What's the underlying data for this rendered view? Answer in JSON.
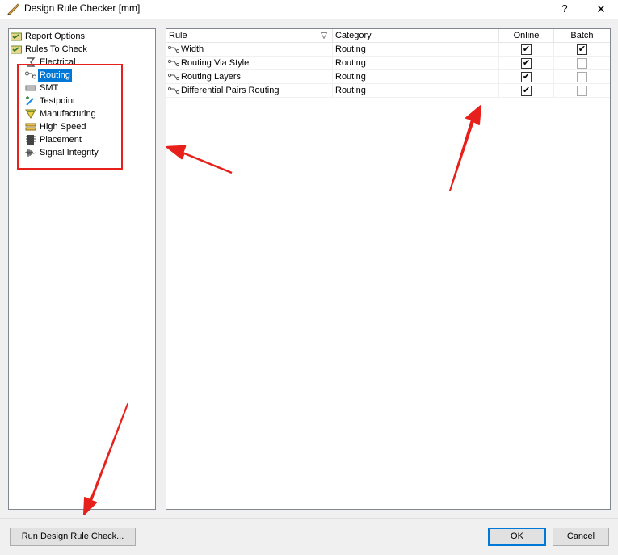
{
  "window": {
    "title": "Design Rule Checker [mm]",
    "help_label": "?",
    "close_label": "✕"
  },
  "tree": {
    "items": [
      {
        "label": "Report Options",
        "icon": "folder-check-icon",
        "selected": false
      },
      {
        "label": "Rules To Check",
        "icon": "folder-check-icon",
        "selected": false
      },
      {
        "label": "Electrical",
        "icon": "electrical-icon",
        "selected": false
      },
      {
        "label": "Routing",
        "icon": "routing-icon",
        "selected": true
      },
      {
        "label": "SMT",
        "icon": "smt-icon",
        "selected": false
      },
      {
        "label": "Testpoint",
        "icon": "testpoint-icon",
        "selected": false
      },
      {
        "label": "Manufacturing",
        "icon": "manufacturing-icon",
        "selected": false
      },
      {
        "label": "High Speed",
        "icon": "high-speed-icon",
        "selected": false
      },
      {
        "label": "Placement",
        "icon": "placement-icon",
        "selected": false
      },
      {
        "label": "Signal Integrity",
        "icon": "signal-integrity-icon",
        "selected": false
      }
    ]
  },
  "grid": {
    "columns": {
      "rule": "Rule",
      "category": "Category",
      "online": "Online",
      "batch": "Batch"
    },
    "rows": [
      {
        "rule": "Width",
        "category": "Routing",
        "online": true,
        "batch": true
      },
      {
        "rule": "Routing Via Style",
        "category": "Routing",
        "online": true,
        "batch": false
      },
      {
        "rule": "Routing Layers",
        "category": "Routing",
        "online": true,
        "batch": false
      },
      {
        "rule": "Differential Pairs Routing",
        "category": "Routing",
        "online": true,
        "batch": false
      }
    ]
  },
  "footer": {
    "run_label_accel": "R",
    "run_label_rest": "un Design Rule Check...",
    "ok_label": "OK",
    "cancel_label": "Cancel"
  },
  "colors": {
    "selection": "#0078d7",
    "annotation": "#e8201c"
  }
}
